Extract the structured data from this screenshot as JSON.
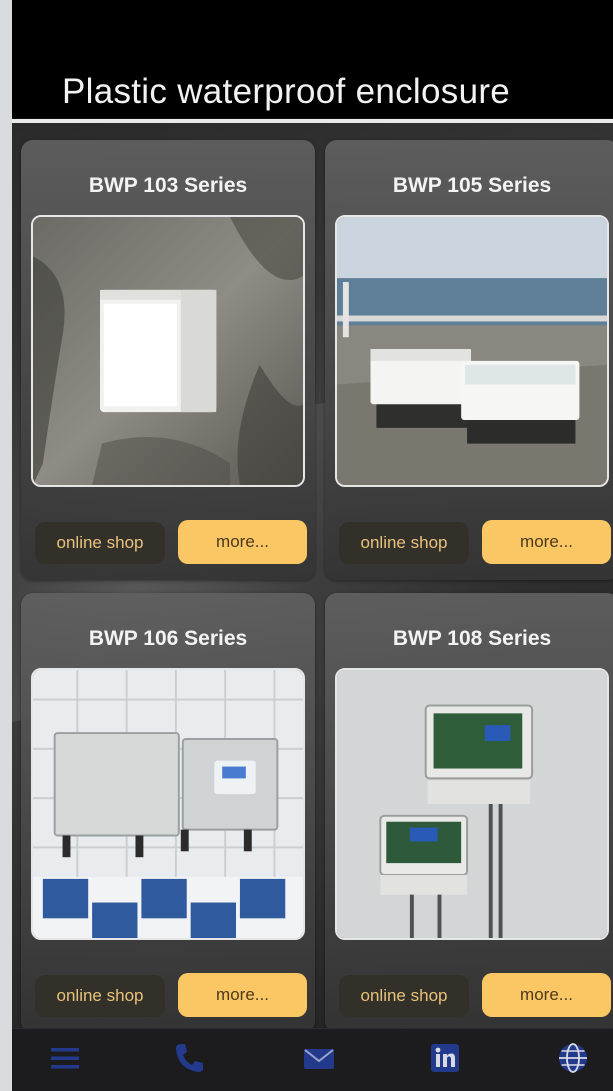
{
  "header": {
    "title": "Plastic waterproof enclosure"
  },
  "cards": [
    {
      "title": "BWP 103 Series",
      "shop_label": "online shop",
      "more_label": "more..."
    },
    {
      "title": "BWP 105 Series",
      "shop_label": "online shop",
      "more_label": "more..."
    },
    {
      "title": "BWP 106 Series",
      "shop_label": "online shop",
      "more_label": "more..."
    },
    {
      "title": "BWP 108 Series",
      "shop_label": "online shop",
      "more_label": "more..."
    }
  ],
  "bottom_nav": {
    "icons": [
      "menu-icon",
      "phone-icon",
      "mail-icon",
      "linkedin-icon",
      "globe-icon"
    ]
  },
  "colors": {
    "header_bg": "#000000",
    "more_button": "#fbc765",
    "shop_button": "#33302a",
    "nav_icon": "#233a8c"
  }
}
